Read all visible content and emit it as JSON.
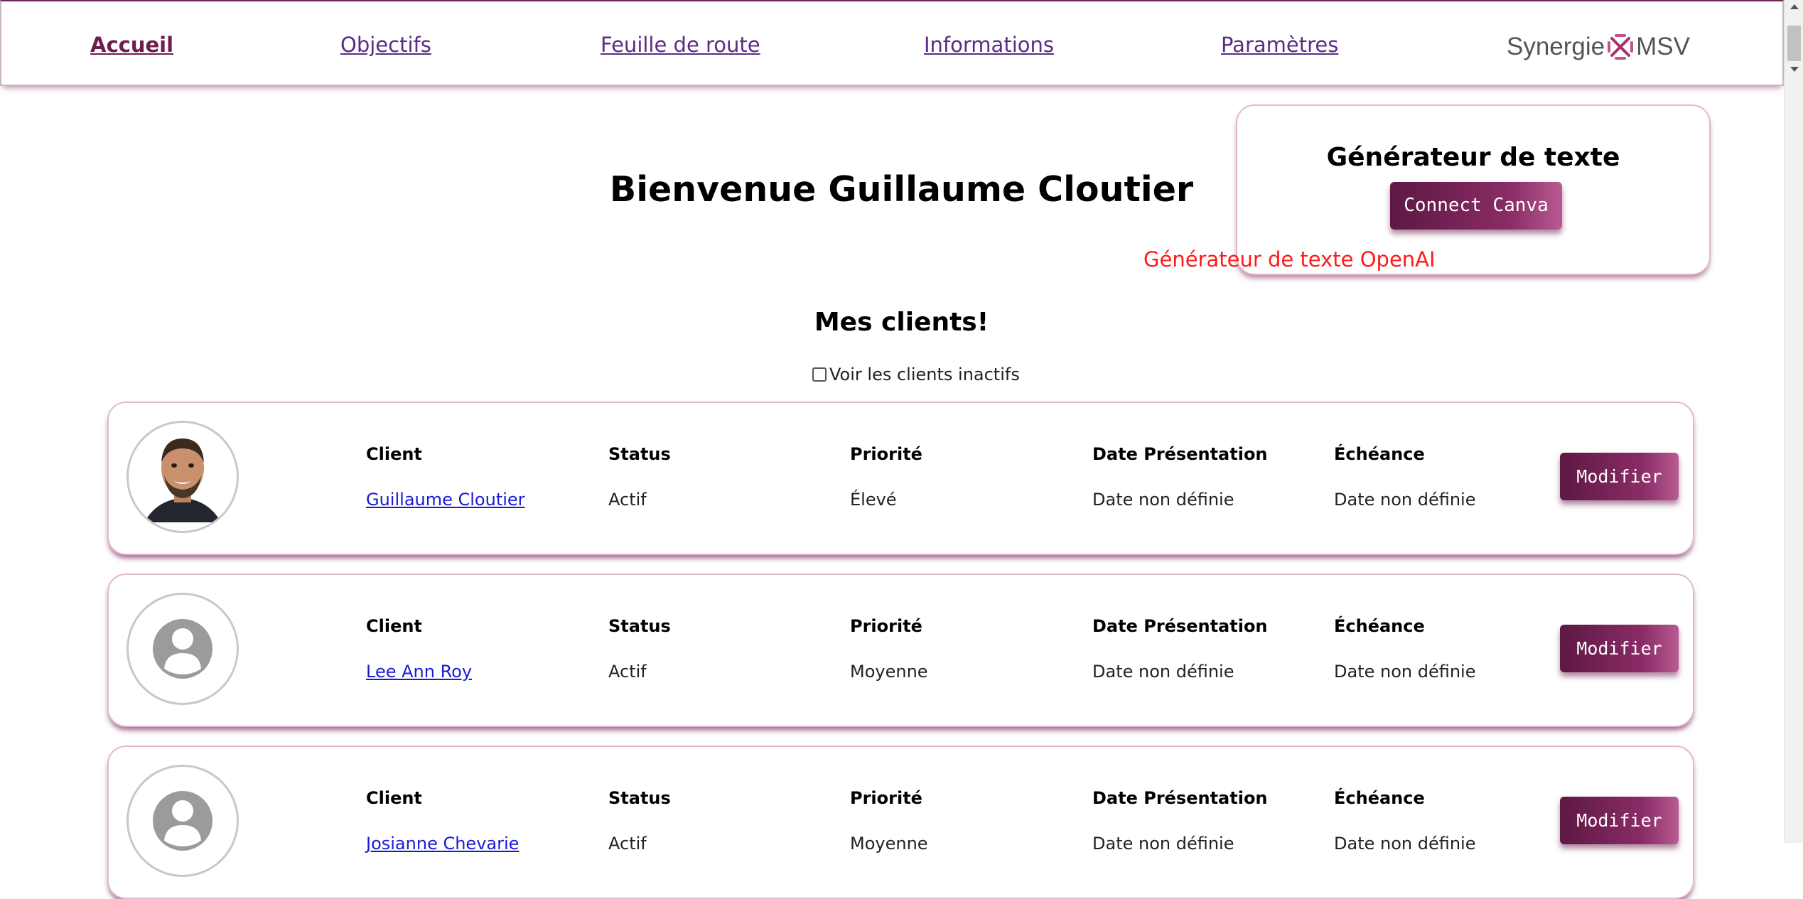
{
  "nav": {
    "items": [
      "Accueil",
      "Objectifs",
      "Feuille de route",
      "Informations",
      "Paramètres"
    ],
    "logo_left": "Synergie",
    "logo_right": "MSV"
  },
  "welcome": "Bienvenue Guillaume Cloutier",
  "generator": {
    "title": "Générateur de texte",
    "button": "Connect Canva",
    "openai_label": "Générateur de texte OpenAI"
  },
  "clients_title": "Mes clients!",
  "inactive_checkbox": {
    "label": "Voir les clients inactifs",
    "checked": false
  },
  "headers": {
    "client": "Client",
    "status": "Status",
    "priority": "Priorité",
    "presentation": "Date Présentation",
    "due": "Échéance"
  },
  "edit_label": "Modifier",
  "clients": [
    {
      "name": "Guillaume Cloutier",
      "status": "Actif",
      "priority": "Élevé",
      "presentation": "Date non définie",
      "due": "Date non définie",
      "avatar": "photo"
    },
    {
      "name": "Lee Ann Roy",
      "status": "Actif",
      "priority": "Moyenne",
      "presentation": "Date non définie",
      "due": "Date non définie",
      "avatar": "placeholder"
    },
    {
      "name": "Josianne Chevarie",
      "status": "Actif",
      "priority": "Moyenne",
      "presentation": "Date non définie",
      "due": "Date non définie",
      "avatar": "placeholder"
    }
  ],
  "colors": {
    "accent": "#6d1d4f",
    "link": "#5b2b86",
    "openai": "#ff1a1a"
  }
}
